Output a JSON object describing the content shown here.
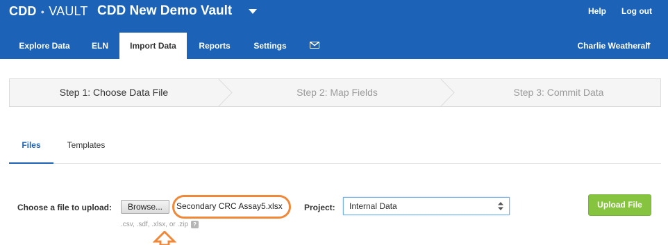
{
  "header": {
    "logo_bold": "CDD",
    "logo_rest": "VAULT",
    "vault_title": "CDD New Demo Vault",
    "help_label": "Help",
    "logout_label": "Log out",
    "bg_color": "#1c63b7"
  },
  "nav": {
    "tabs": [
      {
        "label": "Explore Data",
        "active": false
      },
      {
        "label": "ELN",
        "active": false
      },
      {
        "label": "Import Data",
        "active": true
      },
      {
        "label": "Reports",
        "active": false
      },
      {
        "label": "Settings",
        "active": false
      }
    ],
    "mail_icon": "envelope-icon",
    "user_name": "Charlie Weatherall"
  },
  "steps": [
    {
      "label": "Step 1: Choose Data File",
      "active": true
    },
    {
      "label": "Step 2: Map Fields",
      "active": false
    },
    {
      "label": "Step 3: Commit Data",
      "active": false
    }
  ],
  "subtabs": [
    {
      "label": "Files",
      "active": true
    },
    {
      "label": "Templates",
      "active": false
    }
  ],
  "upload": {
    "choose_label": "Choose a file to upload:",
    "browse_label": "Browse...",
    "file_name": "Secondary CRC Assay5.xlsx",
    "hint": ".csv, .sdf, .xlsx, or .zip",
    "help_icon_text": "?",
    "project_label": "Project:",
    "project_value": "Internal Data",
    "upload_button": "Upload File",
    "highlight_color": "#f0883a",
    "upload_button_color": "#86c440"
  }
}
